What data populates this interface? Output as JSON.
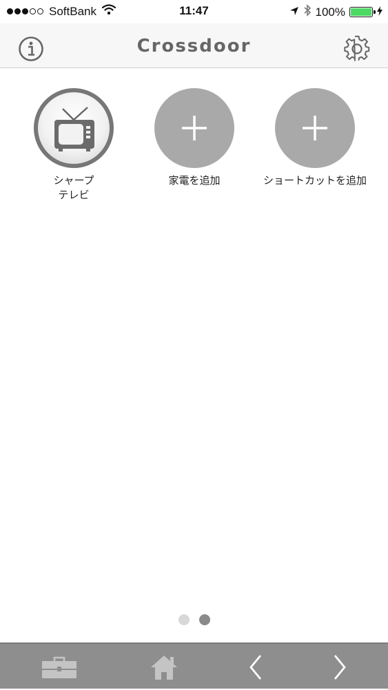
{
  "status_bar": {
    "carrier": "SoftBank",
    "time": "11:47",
    "battery": "100%",
    "signal": {
      "filled": 3,
      "total": 5
    },
    "icons": [
      "wifi-icon",
      "location-arrow-icon",
      "bluetooth-icon",
      "battery-icon",
      "charging-bolt-icon"
    ],
    "battery_color": "#4cd964"
  },
  "nav": {
    "title": "Crossdoor",
    "left_icon": "info-icon",
    "right_icon": "gear-icon"
  },
  "devices": [
    {
      "label": "シャープ\nテレビ",
      "icon": "tv-icon",
      "kind": "device"
    },
    {
      "label": "家電を追加",
      "icon": "plus-icon",
      "kind": "add"
    },
    {
      "label": "ショートカットを追加",
      "icon": "plus-icon",
      "kind": "add"
    }
  ],
  "pager": {
    "pages": 2,
    "current": 2,
    "active_color": "#8a8a8a",
    "inactive_color": "#d8d8d8"
  },
  "toolbar": {
    "items": [
      "toolbox-icon",
      "home-icon",
      "chevron-left-icon",
      "chevron-right-icon"
    ],
    "background": "#8e8e8e"
  }
}
